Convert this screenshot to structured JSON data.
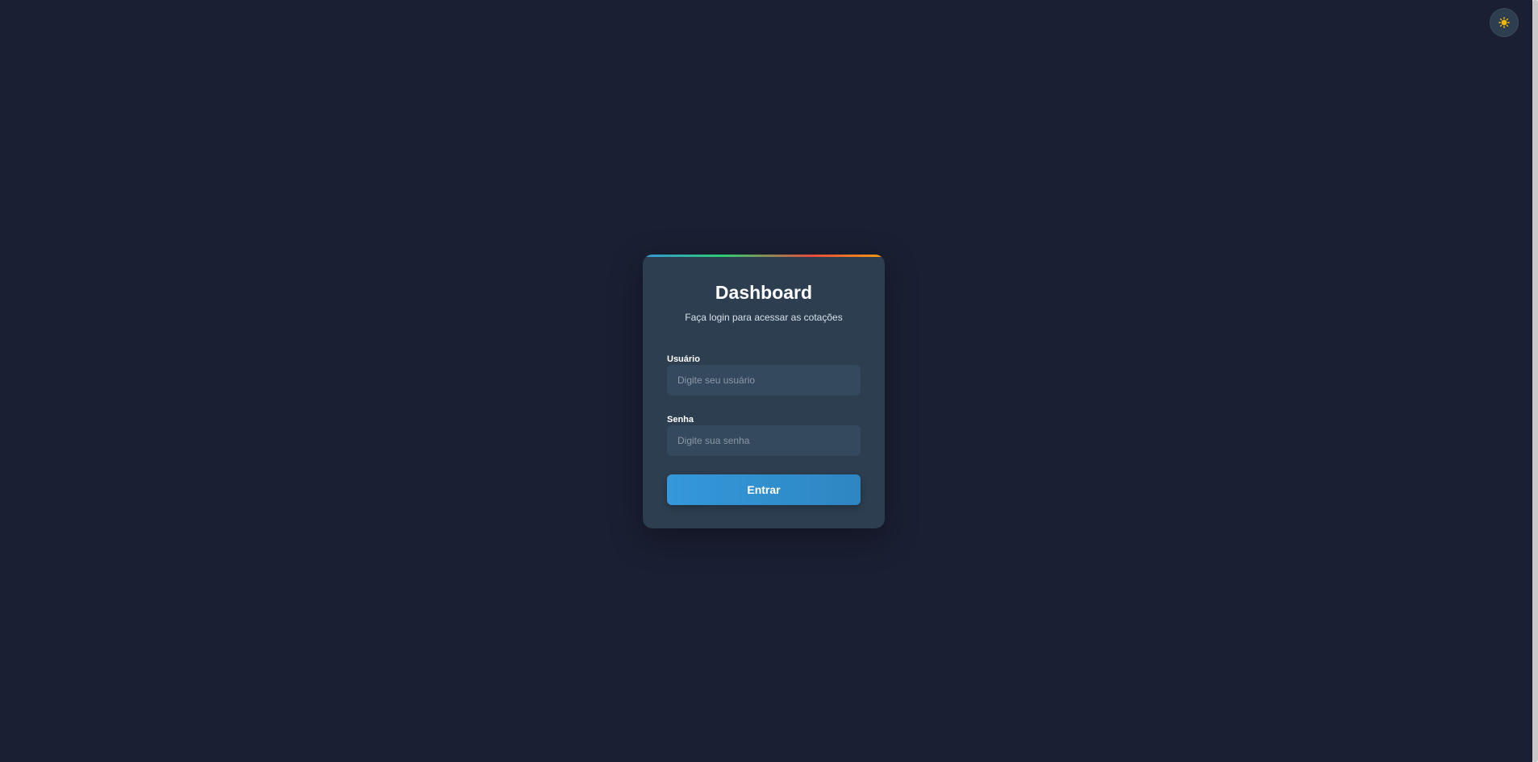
{
  "theme_toggle": {
    "icon": "sun-icon",
    "icon_color": "#f5b800"
  },
  "login": {
    "title": "Dashboard",
    "subtitle": "Faça login para acessar as cotações",
    "username": {
      "label": "Usuário",
      "placeholder": "Digite seu usuário",
      "value": ""
    },
    "password": {
      "label": "Senha",
      "placeholder": "Digite sua senha",
      "value": ""
    },
    "submit_label": "Entrar"
  },
  "colors": {
    "background": "#1a1f33",
    "card": "#2c3e50",
    "input": "#34495e",
    "accent": "#3498db"
  }
}
